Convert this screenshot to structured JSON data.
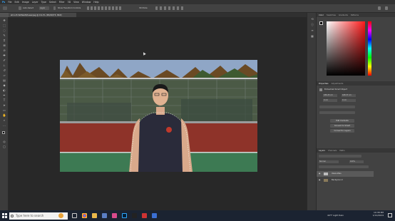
{
  "menu": [
    "Ps",
    "File",
    "Edit",
    "Image",
    "Layer",
    "Type",
    "Select",
    "Filter",
    "3D",
    "View",
    "Window",
    "Help"
  ],
  "options": {
    "auto_select": "Auto-Select",
    "layer": "Layer",
    "transform_controls": "Show Transform Controls",
    "mode_3d": "3D Mode"
  },
  "document_tab": "shrvn5 fehfwsfd/lueanjag @ 16.1% (65/40/73, 8bit)",
  "status_bar": "16% Doc: 28.6M/81.9M",
  "colors": {
    "canvas_bg": "#282828",
    "panel_bg": "#424242",
    "accent": "#1473e6",
    "shirt": "#2a2b3a",
    "court": "#8e3329",
    "turf": "#3d7a53"
  },
  "right_panel": {
    "color_tabs": [
      "Color",
      "Swatches",
      "Gradients",
      "Patterns"
    ],
    "properties_tabs": [
      "Properties",
      "Adjustments"
    ],
    "properties_title": "Embedded Smart Object",
    "transform": {
      "w": "186.25 cm",
      "h": "168.37 cm",
      "x": "0 cm",
      "y": "0 cm"
    },
    "buttons": [
      "Edit Contents",
      "Convert to Smart",
      "Convert to Layers"
    ],
    "layers_tabs": [
      "Layers",
      "Channels",
      "Paths"
    ],
    "blend_mode": "Normal",
    "opacity": "100%",
    "layers": [
      {
        "name": "Ideal-Atlas"
      },
      {
        "name": "Background"
      }
    ]
  },
  "taskbar": {
    "search_placeholder": "Type here to search",
    "weather": "49°F Light Rain",
    "time": "10:38 PM",
    "date": "1/12/2024"
  }
}
